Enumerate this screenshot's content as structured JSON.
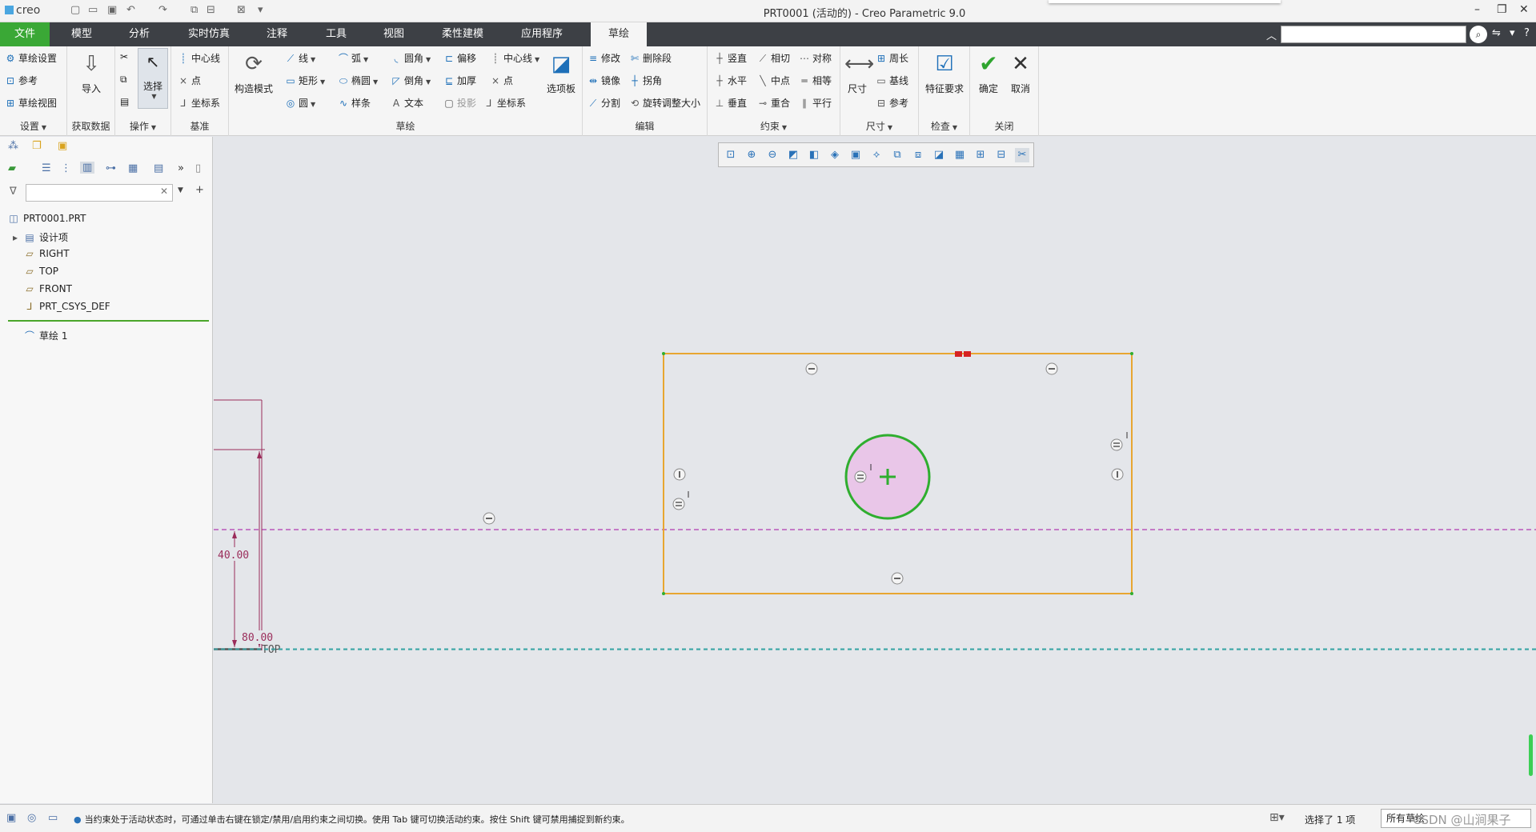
{
  "titlebar": {
    "logo": "creo",
    "title": "PRT0001 (活动的) - Creo Parametric 9.0",
    "min": "–",
    "restore": "❐",
    "close": "✕"
  },
  "tabs": [
    "文件",
    "模型",
    "分析",
    "实时仿真",
    "注释",
    "工具",
    "视图",
    "柔性建模",
    "应用程序",
    "草绘"
  ],
  "ribbon": {
    "setup": {
      "items": [
        "草绘设置",
        "参考",
        "草绘视图"
      ],
      "label": "设置"
    },
    "getdata": {
      "import": "导入",
      "label": "获取数据"
    },
    "ops": {
      "select": "选择",
      "label": "操作"
    },
    "datum": {
      "items": [
        "中心线",
        "点",
        "坐标系"
      ],
      "label": "基准"
    },
    "sketch": {
      "construction": "构造模式",
      "col1": [
        "线",
        "矩形",
        "圆"
      ],
      "col2": [
        "弧",
        "椭圆",
        "样条"
      ],
      "col3": [
        "圆角",
        "倒角",
        "文本"
      ],
      "col4": [
        "偏移",
        "加厚",
        "投影"
      ],
      "col5": [
        "中心线",
        "点",
        "坐标系"
      ],
      "palette": "选项板",
      "label": "草绘"
    },
    "edit": {
      "col1": [
        "修改",
        "镜像",
        "分割"
      ],
      "col2": [
        "删除段",
        "拐角",
        "旋转调整大小"
      ],
      "label": "编辑"
    },
    "constrain": {
      "col1": [
        "竖直",
        "水平",
        "垂直"
      ],
      "col2": [
        "相切",
        "中点",
        "重合"
      ],
      "col3": [
        "对称",
        "相等",
        "平行"
      ],
      "label": "约束"
    },
    "dimension": {
      "dim": "尺寸",
      "items": [
        "周长",
        "基线",
        "参考"
      ],
      "label": "尺寸"
    },
    "inspect": {
      "feature": "特征要求",
      "label": "检查"
    },
    "close": {
      "ok": "确定",
      "cancel": "取消",
      "label": "关闭"
    }
  },
  "tree": {
    "root": "PRT0001.PRT",
    "items": [
      "设计项",
      "RIGHT",
      "TOP",
      "FRONT",
      "PRT_CSYS_DEF"
    ],
    "sketch": "草绘 1"
  },
  "canvas": {
    "dim1": "80.00",
    "dim2": "40.00",
    "top_label": "TOP"
  },
  "status": {
    "message": "当约束处于活动状态时，可通过单击右键在锁定/禁用/启用约束之间切换。使用 Tab 键可切换活动约束。按住 Shift 键可禁用捕捉到新约束。",
    "selected": "选择了 1 项",
    "filter": "所有草绘",
    "watermark": "CSDN @山涧果子"
  },
  "colors": {
    "file_tab": "#3aa836",
    "rect": "#e8a631",
    "circle_stroke": "#2fae2f",
    "circle_fill": "#e9c6e8",
    "dimension": "#9a2c5a",
    "hline": "#b03ab0",
    "top_line": "#3aa5a5"
  }
}
